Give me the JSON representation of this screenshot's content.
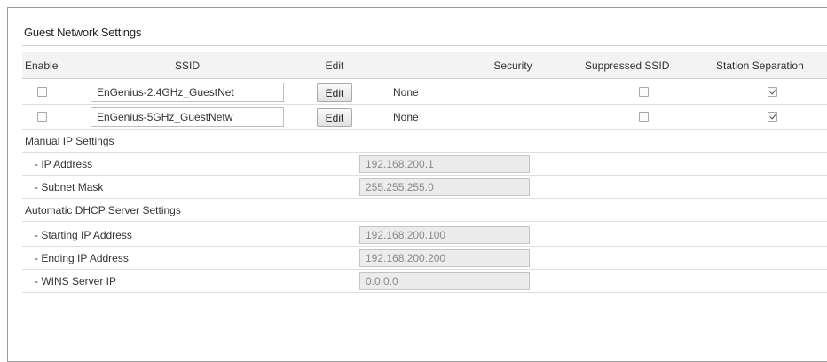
{
  "panel": {
    "title": "Guest Network Settings"
  },
  "table": {
    "headers": {
      "enable": "Enable",
      "ssid": "SSID",
      "edit": "Edit",
      "security": "Security",
      "suppressed_ssid": "Suppressed SSID",
      "station_separation": "Station Separation"
    },
    "rows": [
      {
        "enable": false,
        "ssid": "EnGenius-2.4GHz_GuestNet",
        "edit_label": "Edit",
        "security": "None",
        "suppressed_ssid": false,
        "station_separation": true
      },
      {
        "enable": false,
        "ssid": "EnGenius-5GHz_GuestNetw",
        "edit_label": "Edit",
        "security": "None",
        "suppressed_ssid": false,
        "station_separation": true
      }
    ]
  },
  "manual_ip": {
    "title": "Manual IP Settings",
    "ip_address": {
      "label": "- IP Address",
      "value": "192.168.200.1"
    },
    "subnet_mask": {
      "label": "- Subnet Mask",
      "value": "255.255.255.0"
    }
  },
  "dhcp": {
    "title": "Automatic DHCP Server Settings",
    "starting_ip": {
      "label": "- Starting IP Address",
      "value": "192.168.200.100"
    },
    "ending_ip": {
      "label": "- Ending IP Address",
      "value": "192.168.200.200"
    },
    "wins_ip": {
      "label": "- WINS Server IP",
      "value": "0.0.0.0"
    }
  }
}
